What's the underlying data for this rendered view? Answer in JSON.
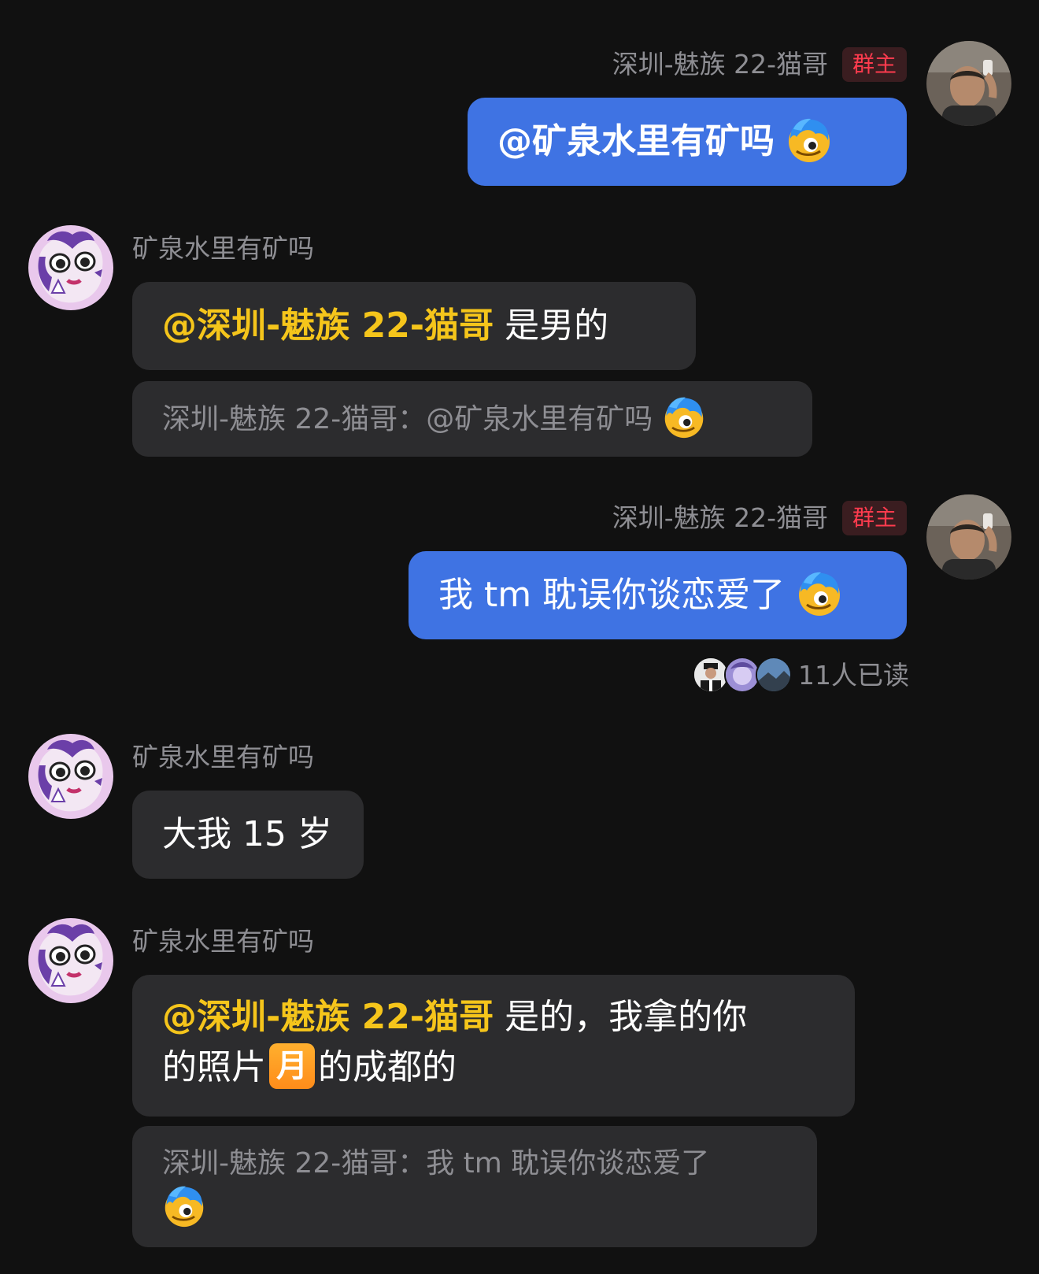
{
  "users": {
    "owner_name": "深圳-魅族 22-猫哥",
    "owner_badge": "群主",
    "other_name": "矿泉水里有矿吗"
  },
  "messages": [
    {
      "sender": "深圳-魅族 22-猫哥",
      "badge": "群主",
      "text": "@矿泉水里有矿吗",
      "emoji": "smirk-emoji-icon"
    },
    {
      "sender": "矿泉水里有矿吗",
      "mention": "@深圳-魅族 22-猫哥",
      "text": " 是男的",
      "quote": "深圳-魅族 22-猫哥：@矿泉水里有矿吗"
    },
    {
      "sender": "深圳-魅族 22-猫哥",
      "badge": "群主",
      "text": "我 tm 耽误你谈恋爱了",
      "emoji": "smirk-emoji-icon",
      "read_status": "11人已读"
    },
    {
      "sender": "矿泉水里有矿吗",
      "text": "大我 15 岁"
    },
    {
      "sender": "矿泉水里有矿吗",
      "mention": "@深圳-魅族 22-猫哥",
      "text_line1": " 是的，我拿的你",
      "text_line2_a": "的照片",
      "moon_char": "月",
      "text_line2_b": "的成都的",
      "quote": "深圳-魅族 22-猫哥：我 tm 耽误你谈恋爱了"
    }
  ],
  "colors": {
    "background": "#111111",
    "blue_bubble": "#3f73e3",
    "gray_bubble": "#2c2c2e",
    "mention": "#f5c51b",
    "badge_text": "#ff3b4e"
  }
}
